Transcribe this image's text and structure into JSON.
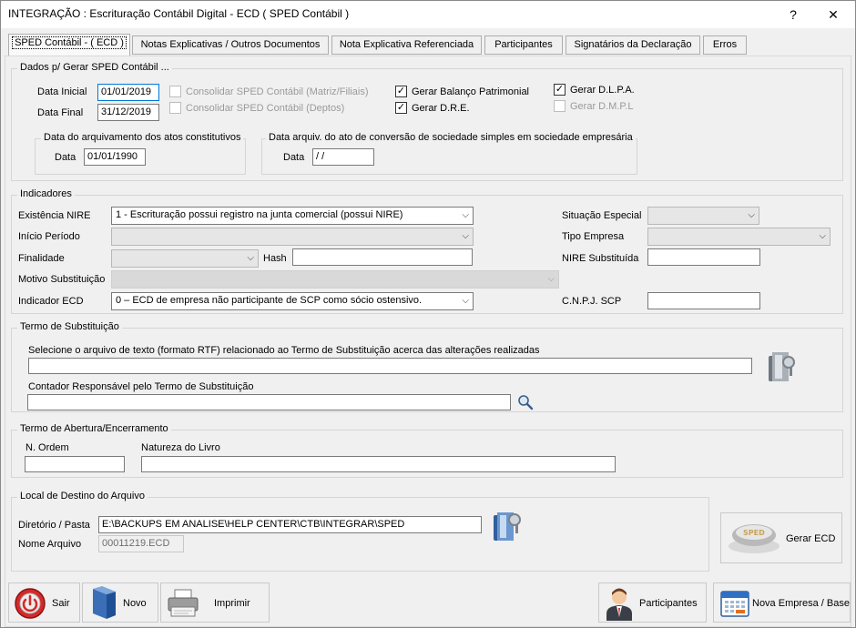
{
  "window": {
    "title": "INTEGRAÇÃO :  Escrituração Contábil Digital - ECD ( SPED Contábil )",
    "help_glyph": "?",
    "close_glyph": "✕"
  },
  "tabs": [
    {
      "label": "SPED Contábil - ( ECD )",
      "active": true
    },
    {
      "label": "Notas Explicativas / Outros Documentos",
      "active": false
    },
    {
      "label": "Nota Explicativa Referenciada",
      "active": false
    },
    {
      "label": "Participantes",
      "active": false
    },
    {
      "label": "Signatários da Declaração",
      "active": false
    },
    {
      "label": "Erros",
      "active": false
    }
  ],
  "dados": {
    "legend": "Dados p/ Gerar SPED Contábil ...",
    "data_inicial_label": "Data Inicial",
    "data_inicial_value": "01/01/2019",
    "data_final_label": "Data Final",
    "data_final_value": "31/12/2019",
    "consolidar_matriz_label": "Consolidar SPED Contábil (Matriz/Filiais)",
    "consolidar_deptos_label": "Consolidar SPED Contábil (Deptos)",
    "gerar_balanco_label": "Gerar Balanço Patrimonial",
    "gerar_dre_label": "Gerar D.R.E.",
    "gerar_dlpa_label": "Gerar D.L.P.A.",
    "gerar_dmpl_label": "Gerar D.M.P.L",
    "check_glyph": "✓",
    "arquivamento_legend": "Data do arquivamento dos atos constitutivos",
    "arquivamento_data_label": "Data",
    "arquivamento_data_value": "01/01/1990",
    "conversao_legend": "Data arquiv. do ato de conversão de sociedade simples em sociedade empresária",
    "conversao_data_label": "Data",
    "conversao_data_value": " /  /"
  },
  "indicadores": {
    "legend": "Indicadores",
    "existencia_nire_label": "Existência NIRE",
    "existencia_nire_value": "1 - Escrituração possui registro na junta comercial (possui NIRE)",
    "inicio_periodo_label": "Início Período",
    "finalidade_label": "Finalidade",
    "hash_label": "Hash",
    "motivo_label": "Motivo Substituição",
    "indicador_ecd_label": "Indicador ECD",
    "indicador_ecd_value": "0 – ECD de empresa não participante de SCP como sócio ostensivo.",
    "situacao_especial_label": "Situação Especial",
    "tipo_empresa_label": "Tipo Empresa",
    "nire_substituida_label": "NIRE Substituída",
    "cnpj_scp_label": "C.N.P.J.  SCP",
    "arrow_glyph": "⌵"
  },
  "termo_substituicao": {
    "legend": "Termo de Substituição",
    "arquivo_label": "Selecione o arquivo de texto (formato RTF) relacionado ao Termo de Substituição acerca das alterações realizadas",
    "contador_label": "Contador Responsável pelo Termo de Substituição"
  },
  "termo_abertura": {
    "legend": "Termo de Abertura/Encerramento",
    "ordem_label": "N. Ordem",
    "natureza_label": "Natureza do Livro"
  },
  "destino": {
    "legend": "Local de Destino do Arquivo",
    "diretorio_label": "Diretório / Pasta",
    "diretorio_value": "E:\\BACKUPS EM ANALISE\\HELP CENTER\\CTB\\INTEGRAR\\SPED",
    "nome_arquivo_label": "Nome Arquivo",
    "nome_arquivo_value": "00011219.ECD"
  },
  "buttons": {
    "gerar_ecd": "Gerar ECD",
    "sped_logo": "SPED",
    "sair": "Sair",
    "novo": "Novo",
    "imprimir": "Imprimir",
    "participantes": "Participantes",
    "nova_empresa": "Nova Empresa / Base"
  },
  "colors": {
    "accent": "#0078d7",
    "sair_red": "#d42a2a",
    "novo_blue": "#3a6fb8"
  }
}
